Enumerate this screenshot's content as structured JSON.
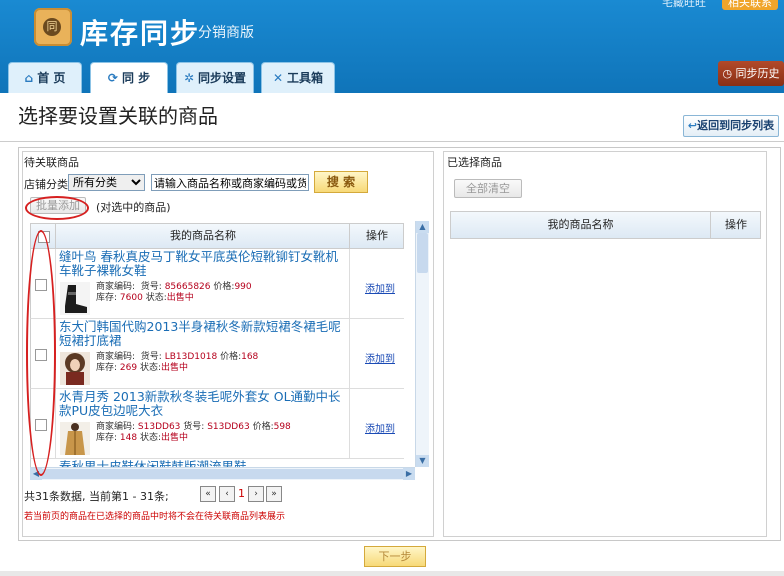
{
  "header": {
    "app_title": "库存同步",
    "app_subtitle": "分销商版",
    "logo_glyph": "同",
    "top_right_text": "宅藏旺旺",
    "top_right_badge": "相关联系",
    "tabs": [
      {
        "icon": "home-icon",
        "glyph": "⌂",
        "label": "首 页"
      },
      {
        "icon": "sync-icon",
        "glyph": "⟳",
        "label": "同 步"
      },
      {
        "icon": "gear-icon",
        "glyph": "✲",
        "label": "同步设置"
      },
      {
        "icon": "tools-icon",
        "glyph": "✕",
        "label": "工具箱"
      }
    ],
    "history_button": "同步历史",
    "history_glyph": "◷"
  },
  "page": {
    "title": "选择要设置关联的商品",
    "back_button": "返回到同步列表",
    "back_glyph": "↩"
  },
  "left_panel": {
    "label": "待关联商品",
    "category_label": "店铺分类",
    "category_selected": "所有分类",
    "search_placeholder": "请输入商品名称或商家编码或货号",
    "search_button": "搜 索",
    "batch_add_button": "批量添加",
    "batch_hint": "(对选中的商品)",
    "columns": [
      "我的商品名称",
      "操作"
    ],
    "rows": [
      {
        "name": "缝叶鸟 春秋真皮马丁靴女平底英伦短靴铆钉女靴机车靴子裸靴女鞋",
        "merchant_code_label": "商家编码:",
        "merchant_code": "",
        "item_no_label": "货号:",
        "item_no": "85665826",
        "price_label": "价格:",
        "price": "990",
        "stock_label": "库存:",
        "stock": "7600",
        "status_label": "状态:",
        "status": "出售中",
        "action": "添加到"
      },
      {
        "name": "东大门韩国代购2013半身裙秋冬新款短裙冬裙毛呢短裙打底裙",
        "merchant_code_label": "商家编码:",
        "merchant_code": "",
        "item_no_label": "货号:",
        "item_no": "LB13D1018",
        "price_label": "价格:",
        "price": "168",
        "stock_label": "库存:",
        "stock": "269",
        "status_label": "状态:",
        "status": "出售中",
        "action": "添加到"
      },
      {
        "name": "水青月秀 2013新款秋冬装毛呢外套女 OL通勤中长款PU皮包边呢大衣",
        "merchant_code_label": "商家编码:",
        "merchant_code": "S13DD63",
        "item_no_label": "货号:",
        "item_no": "S13DD63",
        "price_label": "价格:",
        "price": "598",
        "stock_label": "库存:",
        "stock": "148",
        "status_label": "状态:",
        "status": "出售中",
        "action": "添加到"
      }
    ],
    "partial_row_text": "春秋男士皮鞋休闲鞋韩版潮流男鞋",
    "summary": "共31条数据, 当前第1 - 31条;",
    "pagination": {
      "first": "«",
      "prev": "‹",
      "current": "1",
      "next": "›",
      "last": "»"
    },
    "warning": "若当前页的商品在已选择的商品中时将不会在待关联商品列表展示"
  },
  "right_panel": {
    "label": "已选择商品",
    "clear_button": "全部清空",
    "columns": [
      "我的商品名称",
      "操作"
    ]
  },
  "next_button": "下一步",
  "colors": {
    "header_blue": "#1a8ad2",
    "annotation_red": "#d62020",
    "price_red": "#b5001c",
    "link_blue": "#1a6db5"
  }
}
